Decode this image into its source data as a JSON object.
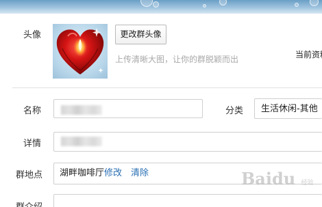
{
  "avatar_section": {
    "label": "头像",
    "change_button": "更改群头像",
    "hint": "上传清晰大图，让你的群脱颖而出",
    "current_info": "当前资料"
  },
  "form": {
    "name_label": "名称",
    "name_value": "",
    "category_label": "分类",
    "category_value": "生活休闲-其他",
    "detail_label": "详情",
    "detail_value": "",
    "place_label": "群地点",
    "place_value": "湖畔咖啡厅",
    "edit_link": "修改",
    "clear_link": "清除",
    "intro_label": "群介绍"
  },
  "watermark": {
    "text": "Bai",
    "tail": "du",
    "suffix": "经验"
  },
  "colors": {
    "link": "#2a6fb3",
    "hint": "#a8a8a8",
    "banner": "#6a9fc6"
  }
}
